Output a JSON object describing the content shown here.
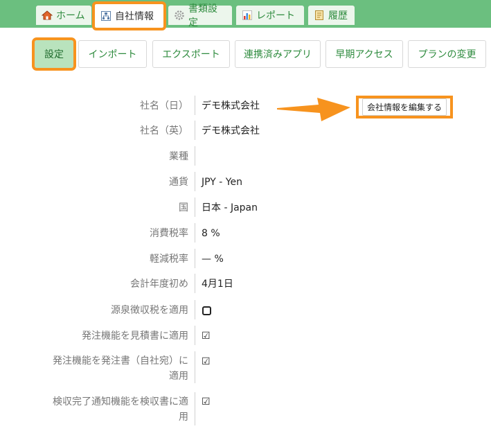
{
  "main_tabs": [
    {
      "label": "ホーム",
      "icon": "home-icon"
    },
    {
      "label": "自社情報",
      "icon": "company-icon"
    },
    {
      "label": "書類設定",
      "icon": "gear-icon"
    },
    {
      "label": "レポート",
      "icon": "bar-chart-icon"
    },
    {
      "label": "履歴",
      "icon": "history-icon"
    }
  ],
  "sub_tabs": [
    "設定",
    "インポート",
    "エクスポート",
    "連携済みアプリ",
    "早期アクセス",
    "プランの変更"
  ],
  "edit_button": "会社情報を編集する",
  "fields": [
    {
      "label": "社名（日）",
      "value": "デモ株式会社"
    },
    {
      "label": "社名（英）",
      "value": "デモ株式会社"
    },
    {
      "label": "業種",
      "value": ""
    },
    {
      "label": "通貨",
      "value": "JPY - Yen"
    },
    {
      "label": "国",
      "value": "日本 - Japan"
    },
    {
      "label": "消費税率",
      "value": "8 %"
    },
    {
      "label": "軽減税率",
      "value": "— %"
    },
    {
      "label": "会計年度初め",
      "value": "4月1日"
    }
  ],
  "checks": [
    {
      "label": "源泉徴収税を適用",
      "checked": false
    },
    {
      "label": "発注機能を見積書に適用",
      "checked": true
    },
    {
      "label_line1": "発注機能を発注書（自社宛）に",
      "label_line2": "適用",
      "checked": true
    },
    {
      "label_line1": "検収完了通知機能を検収書に適",
      "label_line2": "用",
      "checked": true
    }
  ],
  "colors": {
    "accent": "#f7931e",
    "brand_green": "#6bbf7f",
    "link_green": "#2e8b3e"
  }
}
